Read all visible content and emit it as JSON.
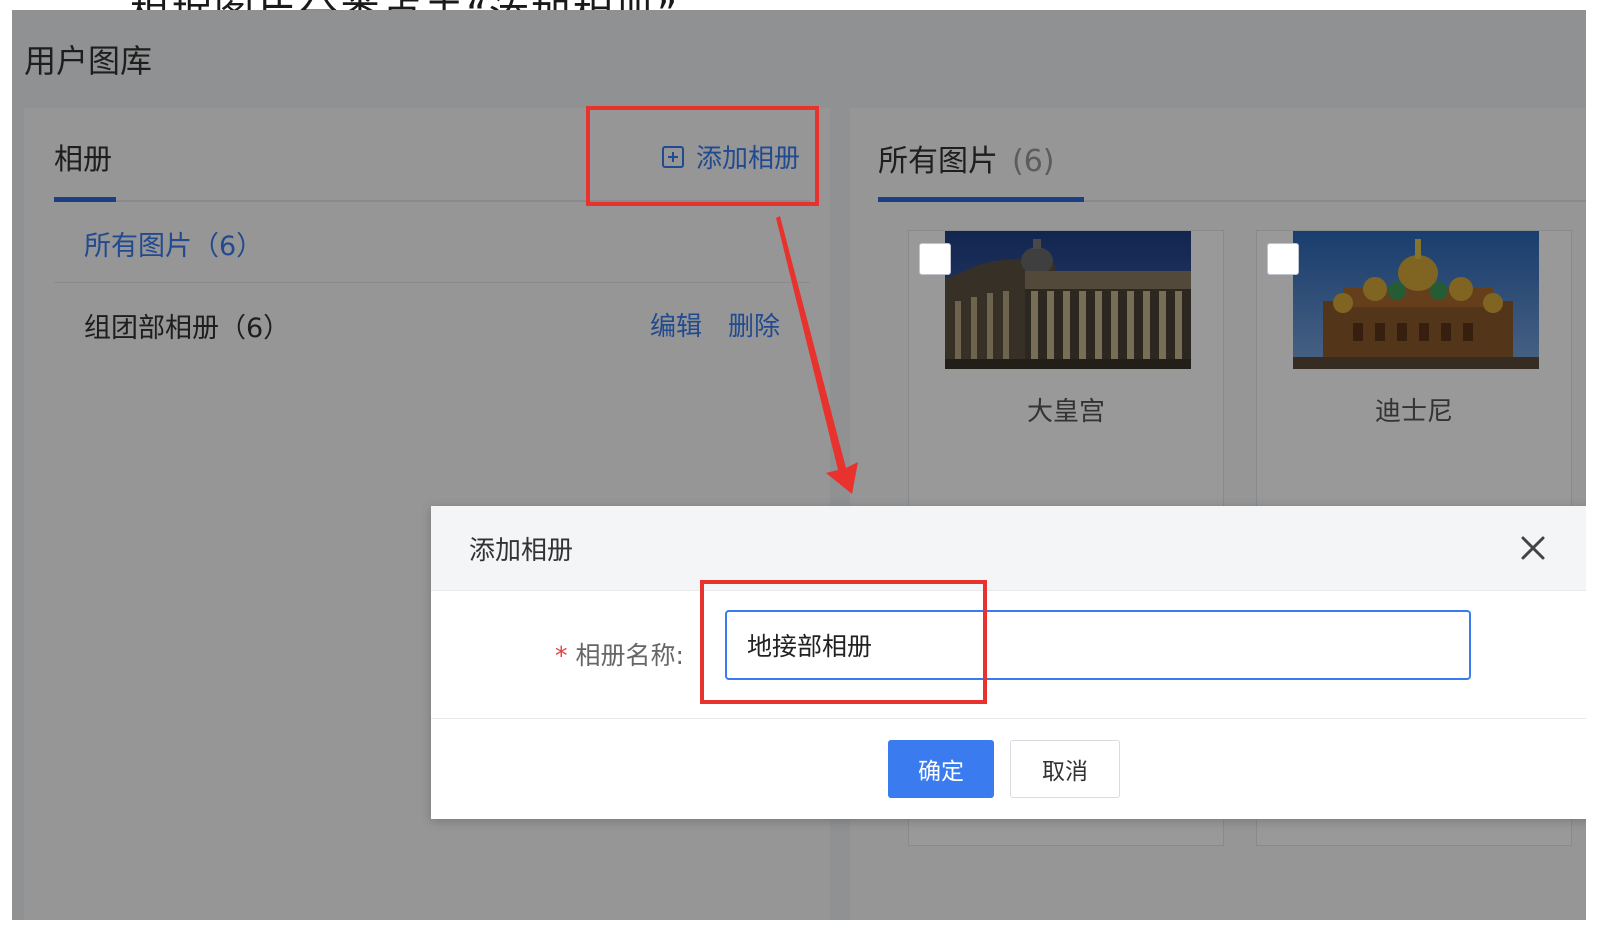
{
  "top_partial_text": "根据图片分类点击“添加相册”",
  "page": {
    "title": "用户图库"
  },
  "album_panel": {
    "tab_label": "相册",
    "add_album_label": "添加相册",
    "albums": [
      {
        "name": "所有图片（6）",
        "active": true
      },
      {
        "name": "组团部相册（6）",
        "active": false,
        "actions": {
          "edit": "编辑",
          "delete": "删除"
        }
      }
    ]
  },
  "images_panel": {
    "tab_label": "所有图片",
    "tab_count": "(6)",
    "images": [
      {
        "caption": "大皇宫"
      },
      {
        "caption": "迪士尼"
      }
    ]
  },
  "dialog": {
    "title": "添加相册",
    "field_required_mark": "*",
    "field_label": "相册名称:",
    "field_value": "地接部相册",
    "confirm_label": "确定",
    "cancel_label": "取消"
  },
  "icons": {
    "add": "plus-square-icon",
    "close": "close-icon"
  },
  "colors": {
    "accent": "#3a7cf0",
    "annotation": "#e8322e",
    "required": "#e0413f"
  }
}
